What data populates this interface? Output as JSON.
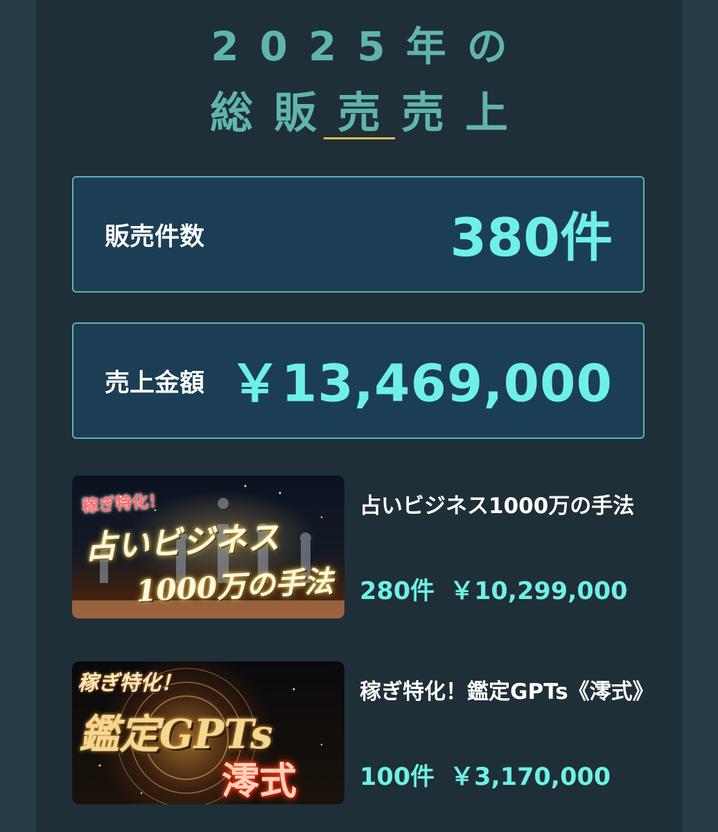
{
  "header": {
    "title_line1": "2025年の",
    "title_line2": "総販売売上"
  },
  "stats": {
    "count_label": "販売件数",
    "count_value": "380件",
    "amount_label": "売上金額",
    "amount_value": "￥13,469,000"
  },
  "products": [
    {
      "name": "占いビジネス1000万の手法",
      "count": "280件",
      "amount": "￥10,299,000",
      "thumb_tag": "稼ぎ特化！",
      "thumb_line1": "占いビジネス",
      "thumb_line2": "1000万の手法"
    },
    {
      "name": "稼ぎ特化！鑑定GPTs《澪式》",
      "count": "100件",
      "amount": "￥3,170,000",
      "thumb_tag": "稼ぎ特化！",
      "thumb_line1": "鑑定GPTs",
      "thumb_line2": "澪式"
    }
  ],
  "colors": {
    "background": "#263b43",
    "panel": "#1f2f37",
    "title": "#5fb5ad",
    "accent_underline": "#d9c055",
    "box_fill": "#1c3e55",
    "box_border": "#5cb5b0",
    "value_cyan": "#6ff0e6"
  }
}
